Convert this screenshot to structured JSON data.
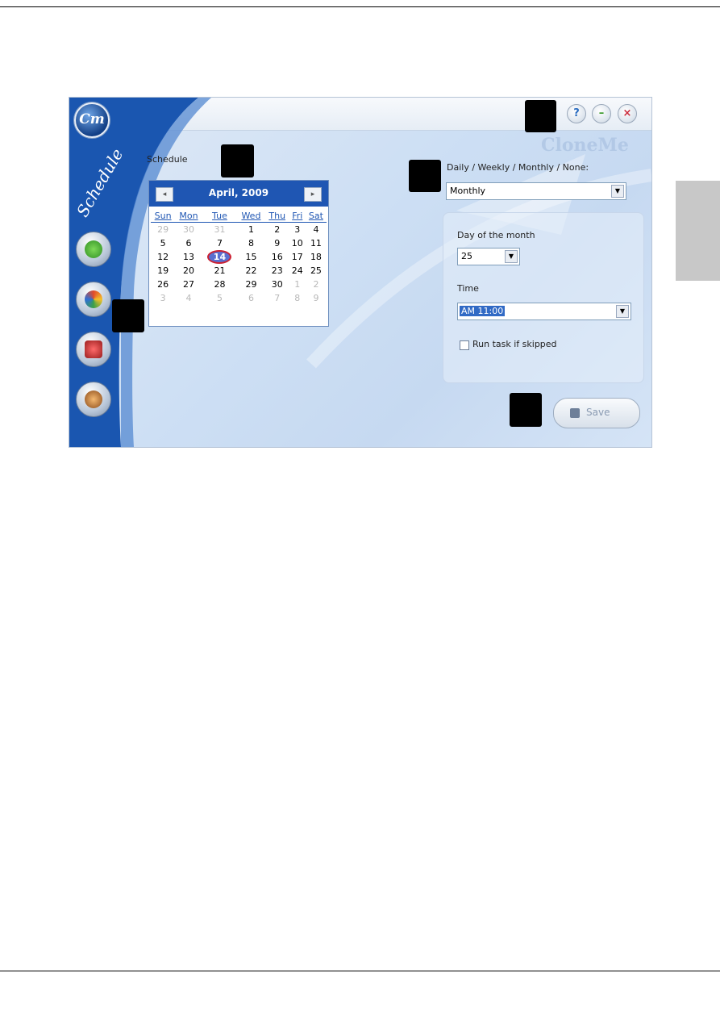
{
  "window": {
    "section_label": "Schedule",
    "sidebar_title": "Schedule",
    "logo_text": "Cm",
    "watermark": "CloneMe",
    "title_buttons": {
      "help": "?",
      "minimize": "–",
      "close": "×"
    }
  },
  "calendar": {
    "title": "April, 2009",
    "prev": "◂",
    "next": "▸",
    "weekdays": [
      "Sun",
      "Mon",
      "Tue",
      "Wed",
      "Thu",
      "Fri",
      "Sat"
    ],
    "weeks": [
      [
        {
          "d": "29",
          "out": true
        },
        {
          "d": "30",
          "out": true
        },
        {
          "d": "31",
          "out": true
        },
        {
          "d": "1"
        },
        {
          "d": "2"
        },
        {
          "d": "3"
        },
        {
          "d": "4"
        }
      ],
      [
        {
          "d": "5"
        },
        {
          "d": "6"
        },
        {
          "d": "7"
        },
        {
          "d": "8"
        },
        {
          "d": "9"
        },
        {
          "d": "10"
        },
        {
          "d": "11"
        }
      ],
      [
        {
          "d": "12"
        },
        {
          "d": "13"
        },
        {
          "d": "14",
          "sel": true
        },
        {
          "d": "15"
        },
        {
          "d": "16"
        },
        {
          "d": "17"
        },
        {
          "d": "18"
        }
      ],
      [
        {
          "d": "19"
        },
        {
          "d": "20"
        },
        {
          "d": "21"
        },
        {
          "d": "22"
        },
        {
          "d": "23"
        },
        {
          "d": "24"
        },
        {
          "d": "25"
        }
      ],
      [
        {
          "d": "26"
        },
        {
          "d": "27"
        },
        {
          "d": "28"
        },
        {
          "d": "29"
        },
        {
          "d": "30"
        },
        {
          "d": "1",
          "out": true
        },
        {
          "d": "2",
          "out": true
        }
      ],
      [
        {
          "d": "3",
          "out": true
        },
        {
          "d": "4",
          "out": true
        },
        {
          "d": "5",
          "out": true
        },
        {
          "d": "6",
          "out": true
        },
        {
          "d": "7",
          "out": true
        },
        {
          "d": "8",
          "out": true
        },
        {
          "d": "9",
          "out": true
        }
      ]
    ]
  },
  "frequency": {
    "label": "Daily / Weekly / Monthly / None:",
    "value": "Monthly"
  },
  "day_of_month": {
    "label": "Day of the month",
    "value": "25"
  },
  "time": {
    "label": "Time",
    "value": "AM 11:00"
  },
  "run_if_skipped": {
    "label": "Run task if skipped",
    "checked": false
  },
  "save_button": {
    "label": "Save"
  },
  "colors": {
    "accent": "#1f56b3",
    "sidebar": "#1a56b0"
  }
}
